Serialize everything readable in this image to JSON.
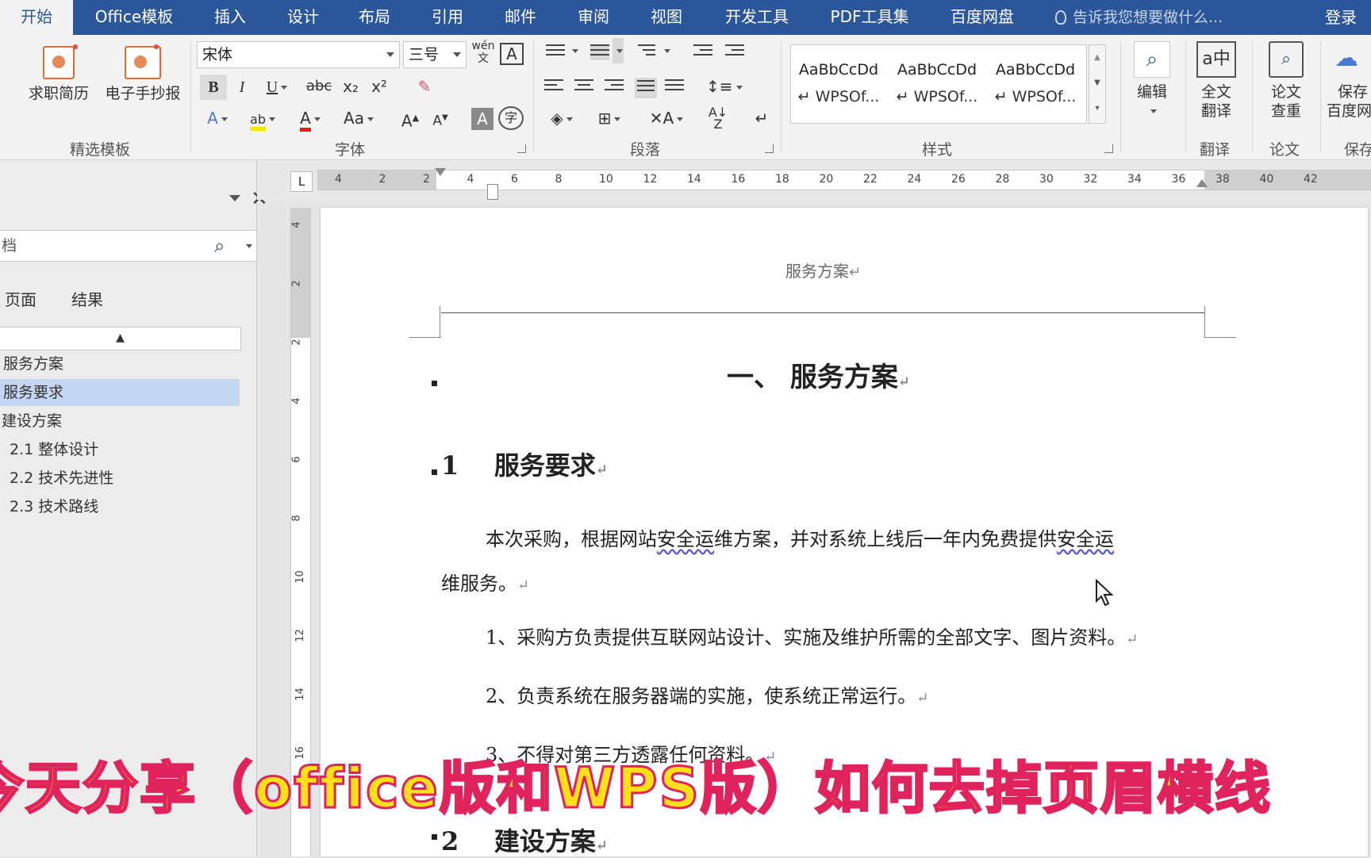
{
  "tabs": [
    "开始",
    "Office模板",
    "插入",
    "设计",
    "布局",
    "引用",
    "邮件",
    "审阅",
    "视图",
    "开发工具",
    "PDF工具集",
    "百度网盘"
  ],
  "tell_me": "告诉我您想要做什么...",
  "login": "登录",
  "ribbon": {
    "template_group": {
      "resume": "求职简历",
      "handcopy": "电子手抄报",
      "label": "精选模板"
    },
    "font_group": {
      "font_name": "宋体",
      "font_size": "三号",
      "phonetic": "wén",
      "bold": "B",
      "italic": "I",
      "underline": "U",
      "strike": "abc",
      "sub": "x₂",
      "sup": "x²",
      "font_color": "A",
      "case": "Aa",
      "grow": "A",
      "shrink": "A",
      "label": "字体"
    },
    "para_group": {
      "label": "段落"
    },
    "styles_group": {
      "items": [
        {
          "sample": "AaBbCcDd",
          "name": "↵ WPSOf..."
        },
        {
          "sample": "AaBbCcDd",
          "name": "↵ WPSOf..."
        },
        {
          "sample": "AaBbCcDd",
          "name": "↵ WPSOf..."
        }
      ],
      "label": "样式"
    },
    "edit": "编辑",
    "translate": {
      "line1": "全文",
      "line2": "翻译",
      "label": "翻译"
    },
    "paper": {
      "line1": "论文",
      "line2": "查重",
      "label": "论文"
    },
    "save": {
      "line1": "保存",
      "line2": "百度网",
      "label": "保存"
    }
  },
  "nav": {
    "search_value": "档",
    "tabs": [
      "页面",
      "结果"
    ],
    "items": [
      {
        "text": "服务方案",
        "level": 1,
        "selected": false
      },
      {
        "text": "服务要求",
        "level": 1,
        "selected": true
      },
      {
        "text": "建设方案",
        "level": 1,
        "selected": false
      },
      {
        "text": "2.1 整体设计",
        "level": 2,
        "selected": false
      },
      {
        "text": "2.2 技术先进性",
        "level": 2,
        "selected": false
      },
      {
        "text": "2.3 技术路线",
        "level": 2,
        "selected": false
      }
    ]
  },
  "ruler": {
    "h_ticks": [
      "4",
      "2",
      "2",
      "4",
      "6",
      "8",
      "10",
      "12",
      "14",
      "16",
      "18",
      "20",
      "22",
      "24",
      "26",
      "28",
      "30",
      "32",
      "34",
      "36",
      "38",
      "40",
      "42"
    ],
    "v_ticks": [
      "4",
      "2",
      "2",
      "4",
      "6",
      "8",
      "10",
      "12",
      "14",
      "16"
    ],
    "corner": "L"
  },
  "document": {
    "header": "服务方案",
    "title": "一、  服务方案",
    "h_1_num": "1",
    "h_1": "服务要求",
    "para1_a": "本次采购，根据网站",
    "para1_b": "安全运",
    "para1_c": "维方案，并对系统上线后一年内免费提供",
    "para1_d": "安全运",
    "para1_e": "维服务。",
    "item1": "1、采购方负责提供互联网站设计、实施及维护所需的全部文字、图片资料。",
    "item2": "2、负责系统在服务器端的实施，使系统正常运行。",
    "item3": "3、不得对第三方透露任何资料。",
    "h_2_num": "2",
    "h_2": "建设方案",
    "para_mark": "↵"
  },
  "overlay_caption": "今天分享（office版和WPS版）如何去掉页眉横线"
}
